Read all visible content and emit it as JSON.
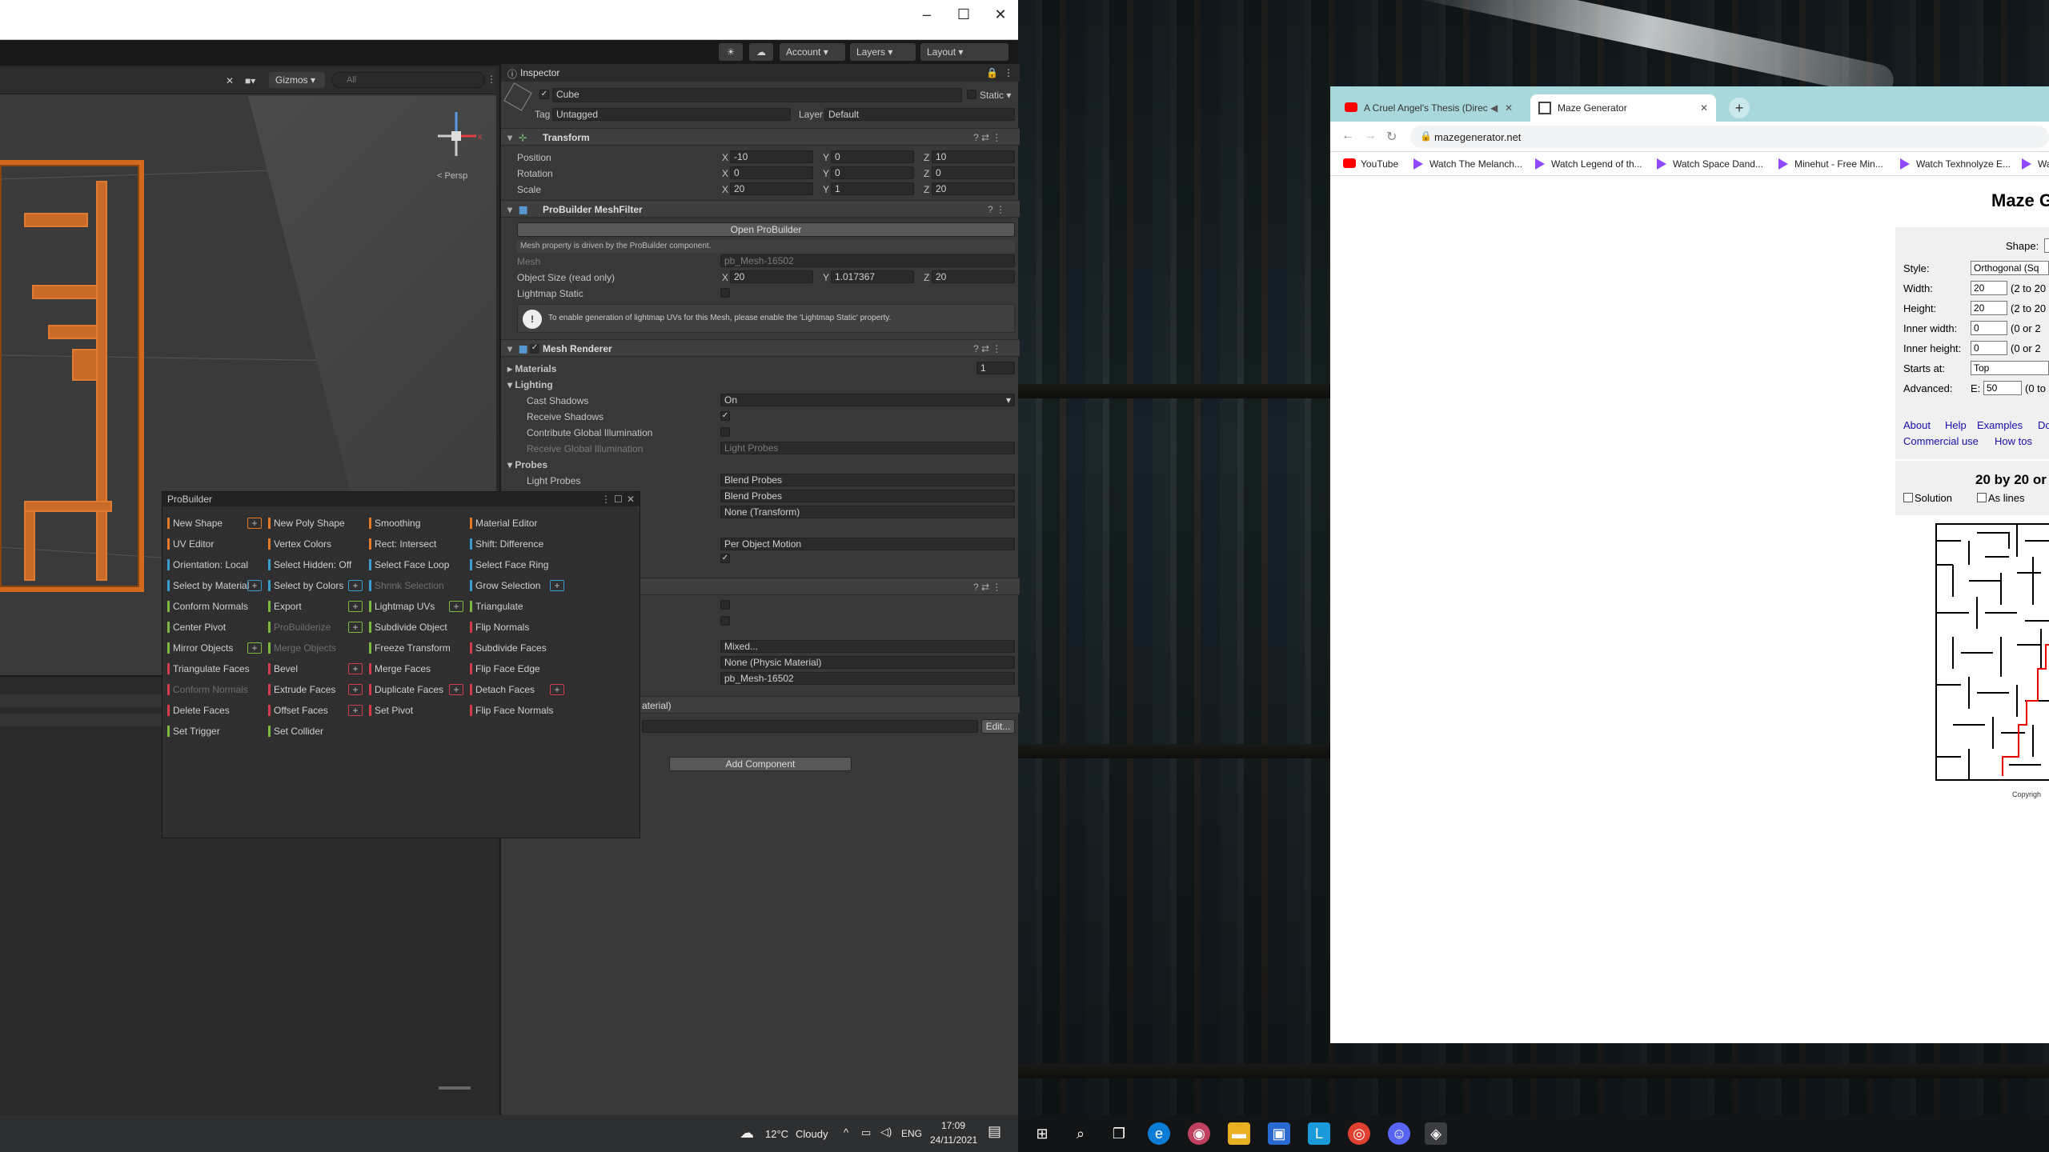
{
  "unity": {
    "toolbar": {
      "account": "Account",
      "layers": "Layers",
      "layout": "Layout"
    },
    "scene": {
      "gizmos": "Gizmos",
      "search_placeholder": "All",
      "persp": "< Persp"
    },
    "inspector": {
      "tab": "Inspector",
      "object_name": "Cube",
      "static_label": "Static",
      "tag_label": "Tag",
      "tag_value": "Untagged",
      "layer_label": "Layer",
      "layer_value": "Default",
      "transform": {
        "title": "Transform",
        "position_label": "Position",
        "position": {
          "x": "-10",
          "y": "0",
          "z": "10"
        },
        "rotation_label": "Rotation",
        "rotation": {
          "x": "0",
          "y": "0",
          "z": "0"
        },
        "scale_label": "Scale",
        "scale": {
          "x": "20",
          "y": "1",
          "z": "20"
        }
      },
      "meshfilter": {
        "title": "ProBuilder MeshFilter",
        "open_button": "Open ProBuilder",
        "note": "Mesh property is driven by the ProBuilder component.",
        "mesh_label": "Mesh",
        "mesh_value": "pb_Mesh-16502",
        "size_label": "Object Size (read only)",
        "size": {
          "x": "20",
          "y": "1.017367",
          "z": "20"
        },
        "lightmap_label": "Lightmap Static",
        "warning": "To enable generation of lightmap UVs for this Mesh, please enable the 'Lightmap Static' property."
      },
      "renderer": {
        "title": "Mesh Renderer",
        "materials_label": "Materials",
        "materials_count": "1",
        "lighting_label": "Lighting",
        "cast_label": "Cast Shadows",
        "cast_value": "On",
        "receive_label": "Receive Shadows",
        "contribute_label": "Contribute Global Illumination",
        "receive_gi_label": "Receive Global Illumination",
        "receive_gi_value": "Light Probes",
        "probes_label": "Probes",
        "light_probes_label": "Light Probes",
        "light_probes_value": "Blend Probes",
        "reflection_value": "Blend Probes",
        "anchor_value": "None (Transform)",
        "motion_value": "Per Object Motion"
      },
      "collider": {
        "mixed_value": "Mixed...",
        "material_value": "None (Physic Material)",
        "mesh_value": "pb_Mesh-16502",
        "shader_fragment": "aterial)",
        "edit_button": "Edit..."
      },
      "add_component": "Add Component"
    },
    "probuilder": {
      "title": "ProBuilder",
      "items": [
        {
          "label": "New Shape",
          "color": "#e07a2a",
          "plus": true,
          "disabled": false
        },
        {
          "label": "New Poly Shape",
          "color": "#e07a2a",
          "plus": false,
          "disabled": false
        },
        {
          "label": "Smoothing",
          "color": "#e07a2a",
          "plus": false,
          "disabled": false
        },
        {
          "label": "Material Editor",
          "color": "#e07a2a",
          "plus": false,
          "disabled": false
        },
        {
          "label": "UV Editor",
          "color": "#e07a2a",
          "plus": false,
          "disabled": false
        },
        {
          "label": "Vertex Colors",
          "color": "#e07a2a",
          "plus": false,
          "disabled": false
        },
        {
          "label": "Rect: Intersect",
          "color": "#e07a2a",
          "plus": false,
          "disabled": false
        },
        {
          "label": "Shift: Difference",
          "color": "#3a9ad0",
          "plus": false,
          "disabled": false
        },
        {
          "label": "Orientation: Local",
          "color": "#3a9ad0",
          "plus": false,
          "disabled": false
        },
        {
          "label": "Select Hidden: Off",
          "color": "#3a9ad0",
          "plus": false,
          "disabled": false
        },
        {
          "label": "Select Face Loop",
          "color": "#3a9ad0",
          "plus": false,
          "disabled": false
        },
        {
          "label": "Select Face Ring",
          "color": "#3a9ad0",
          "plus": false,
          "disabled": false
        },
        {
          "label": "Select by Material",
          "color": "#3a9ad0",
          "plus": true,
          "disabled": false
        },
        {
          "label": "Select by Colors",
          "color": "#3a9ad0",
          "plus": true,
          "disabled": false
        },
        {
          "label": "Shrink Selection",
          "color": "#3a9ad0",
          "plus": false,
          "disabled": true
        },
        {
          "label": "Grow Selection",
          "color": "#3a9ad0",
          "plus": true,
          "disabled": false
        },
        {
          "label": "Conform Normals",
          "color": "#7ab840",
          "plus": false,
          "disabled": false
        },
        {
          "label": "Export",
          "color": "#7ab840",
          "plus": true,
          "disabled": false
        },
        {
          "label": "Lightmap UVs",
          "color": "#7ab840",
          "plus": true,
          "disabled": false
        },
        {
          "label": "Triangulate",
          "color": "#7ab840",
          "plus": false,
          "disabled": false
        },
        {
          "label": "Center Pivot",
          "color": "#7ab840",
          "plus": false,
          "disabled": false
        },
        {
          "label": "ProBuilderize",
          "color": "#7ab840",
          "plus": true,
          "disabled": true
        },
        {
          "label": "Subdivide Object",
          "color": "#7ab840",
          "plus": false,
          "disabled": false
        },
        {
          "label": "Flip Normals",
          "color": "#d23c4c",
          "plus": false,
          "disabled": false
        },
        {
          "label": "Mirror Objects",
          "color": "#7ab840",
          "plus": true,
          "disabled": false
        },
        {
          "label": "Merge Objects",
          "color": "#7ab840",
          "plus": false,
          "disabled": true
        },
        {
          "label": "Freeze Transform",
          "color": "#7ab840",
          "plus": false,
          "disabled": false
        },
        {
          "label": "Subdivide Faces",
          "color": "#d23c4c",
          "plus": false,
          "disabled": false
        },
        {
          "label": "Triangulate Faces",
          "color": "#d23c4c",
          "plus": false,
          "disabled": false
        },
        {
          "label": "Bevel",
          "color": "#d23c4c",
          "plus": true,
          "disabled": false
        },
        {
          "label": "Merge Faces",
          "color": "#d23c4c",
          "plus": false,
          "disabled": false
        },
        {
          "label": "Flip Face Edge",
          "color": "#d23c4c",
          "plus": false,
          "disabled": false
        },
        {
          "label": "Conform Normals",
          "color": "#d23c4c",
          "plus": false,
          "disabled": true
        },
        {
          "label": "Extrude Faces",
          "color": "#d23c4c",
          "plus": true,
          "disabled": false
        },
        {
          "label": "Duplicate Faces",
          "color": "#d23c4c",
          "plus": true,
          "disabled": false
        },
        {
          "label": "Detach Faces",
          "color": "#d23c4c",
          "plus": true,
          "disabled": false
        },
        {
          "label": "Delete Faces",
          "color": "#d23c4c",
          "plus": false,
          "disabled": false
        },
        {
          "label": "Offset Faces",
          "color": "#d23c4c",
          "plus": true,
          "disabled": false
        },
        {
          "label": "Set Pivot",
          "color": "#d23c4c",
          "plus": false,
          "disabled": false
        },
        {
          "label": "Flip Face Normals",
          "color": "#d23c4c",
          "plus": false,
          "disabled": false
        },
        {
          "label": "Set Trigger",
          "color": "#7ab840",
          "plus": false,
          "disabled": false
        },
        {
          "label": "Set Collider",
          "color": "#7ab840",
          "plus": false,
          "disabled": false
        }
      ]
    }
  },
  "browser": {
    "tabs": [
      {
        "title": "A Cruel Angel's Thesis (Direc",
        "active": false
      },
      {
        "title": "Maze Generator",
        "active": true
      }
    ],
    "url": "mazegenerator.net",
    "bookmarks": [
      "YouTube",
      "Watch The Melanch...",
      "Watch Legend of th...",
      "Watch Space Dand...",
      "Minehut - Free Min...",
      "Watch Texhnolyze E...",
      "Wa"
    ],
    "page": {
      "title": "Maze G",
      "shape_label": "Shape:",
      "fields": [
        {
          "label": "Style:",
          "value": "Orthogonal (Sq",
          "hint": ""
        },
        {
          "label": "Width:",
          "value": "20",
          "hint": "(2 to 20"
        },
        {
          "label": "Height:",
          "value": "20",
          "hint": "(2 to 20"
        },
        {
          "label": "Inner width:",
          "value": "0",
          "hint": "(0 or 2"
        },
        {
          "label": "Inner height:",
          "value": "0",
          "hint": "(0 or 2"
        },
        {
          "label": "Starts at:",
          "value": "Top",
          "hint": ""
        }
      ],
      "advanced_label": "Advanced:",
      "advanced_e": "E:",
      "advanced_value": "50",
      "advanced_hint": "(0 to",
      "links_row1": [
        "About",
        "Help",
        "Examples",
        "Do"
      ],
      "links_row2": [
        "Commercial use",
        "How tos"
      ],
      "maze_title": "20 by 20 or",
      "solution_label": "Solution",
      "aslines_label": "As lines",
      "copyright": "Copyrigh"
    }
  },
  "taskbar": {
    "weather_temp": "12°C",
    "weather_desc": "Cloudy",
    "language": "ENG",
    "time": "17:09",
    "date": "24/11/2021"
  }
}
